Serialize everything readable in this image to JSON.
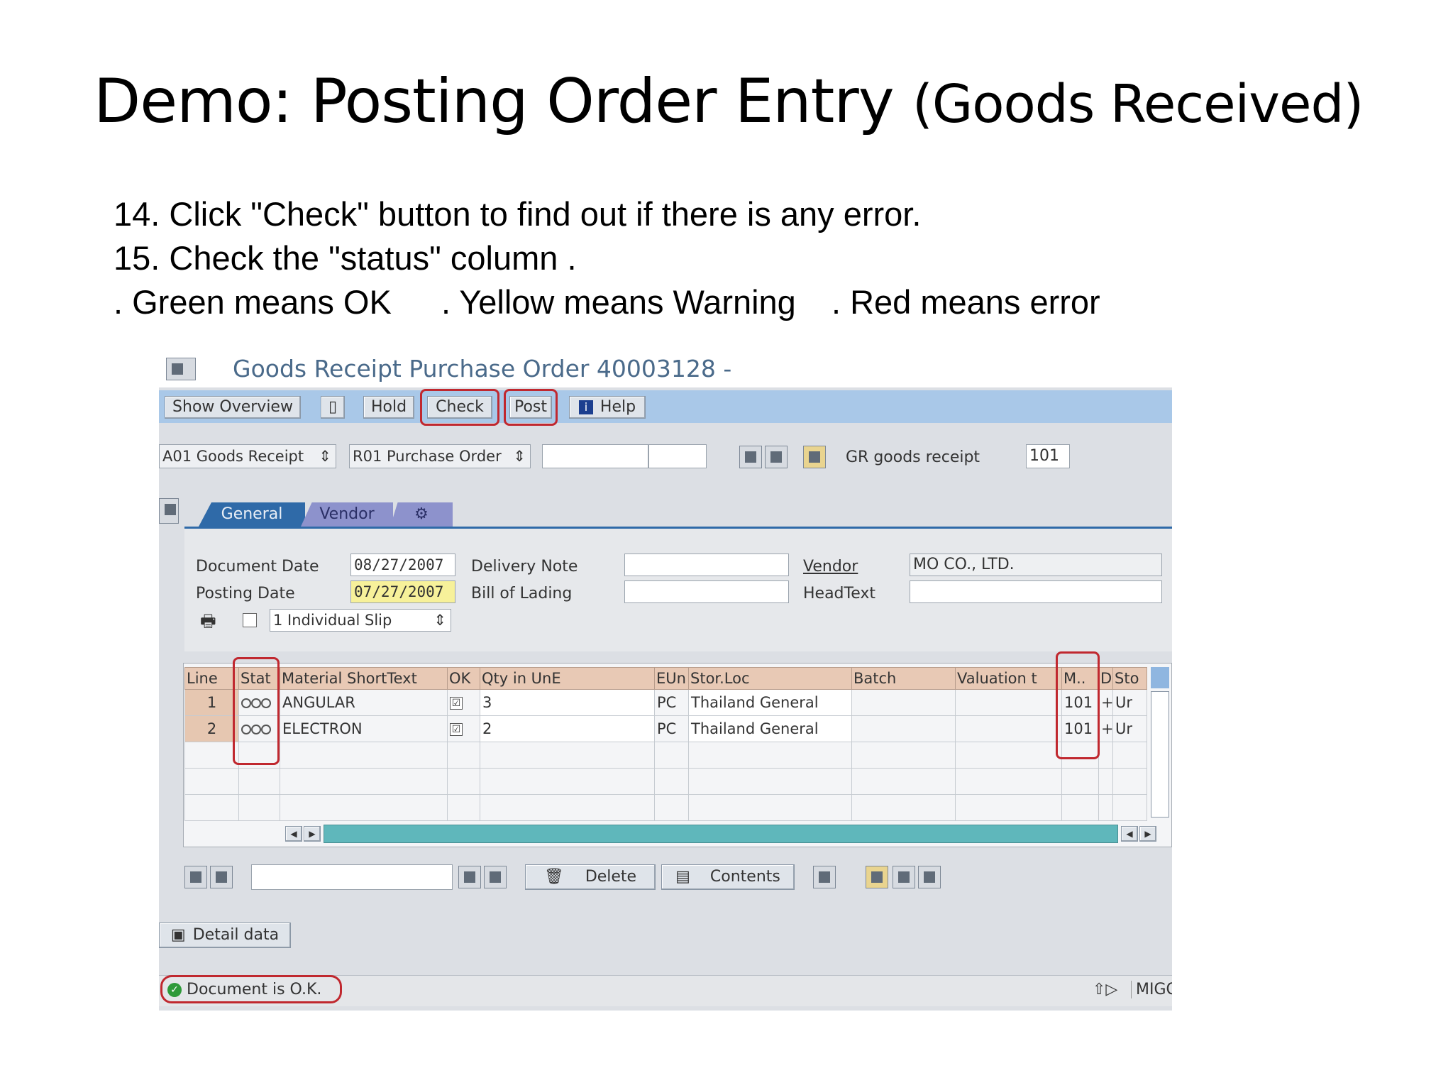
{
  "slide": {
    "title_main": "Demo: Posting Order Entry",
    "title_sub": "(Goods Received)",
    "steps": [
      "14. Click \"Check\" button to find out if there is any error.",
      "15. Check the \"status\" column ."
    ],
    "legend": {
      "green": ". Green means OK",
      "yellow": ". Yellow means Warning",
      "red": ". Red means error"
    }
  },
  "sap": {
    "window_title": "Goods Receipt Purchase Order 40003128 -",
    "toolbar": {
      "show_overview": "Show Overview",
      "hold": "Hold",
      "check": "Check",
      "post": "Post",
      "help": "Help"
    },
    "selectors": {
      "action": "A01 Goods Receipt",
      "reference": "R01 Purchase Order",
      "gr_label": "GR goods receipt",
      "movement_type": "101"
    },
    "tabs": [
      "General",
      "Vendor",
      "⚙"
    ],
    "header_fields": {
      "document_date_label": "Document Date",
      "document_date": "08/27/2007",
      "posting_date_label": "Posting Date",
      "posting_date": "07/27/2007",
      "delivery_note_label": "Delivery Note",
      "bill_of_lading_label": "Bill of Lading",
      "vendor_label": "Vendor",
      "vendor_value": "MO CO., LTD.",
      "headtext_label": "HeadText",
      "slip_option": "1 Individual Slip"
    },
    "items": {
      "columns": [
        "Line",
        "Stat",
        "Material ShortText",
        "OK",
        "Qty in UnE",
        "EUn",
        "Stor.Loc",
        "Batch",
        "Valuation t",
        "M..",
        "D",
        "Sto"
      ],
      "rows": [
        {
          "line": "1",
          "material": "ANGULAR",
          "ok": "☑",
          "qty": "3",
          "eun": "PC",
          "storloc": "Thailand General",
          "mvt": "101",
          "d": "+",
          "sto": "Ur"
        },
        {
          "line": "2",
          "material": "ELECTRON",
          "ok": "☑",
          "qty": "2",
          "eun": "PC",
          "storloc": "Thailand General",
          "mvt": "101",
          "d": "+",
          "sto": "Ur"
        }
      ]
    },
    "bottom": {
      "delete": "Delete",
      "contents": "Contents",
      "detail_data": "Detail data"
    },
    "status": {
      "message": "Document is O.K.",
      "system": "MIGO"
    },
    "colors": {
      "toolbar": "#a9c8e8",
      "table_header": "#e8c9b5",
      "highlight_ring": "#c0282f",
      "tab_active": "#2f6aa8",
      "tab_inactive": "#8d92cc"
    }
  }
}
